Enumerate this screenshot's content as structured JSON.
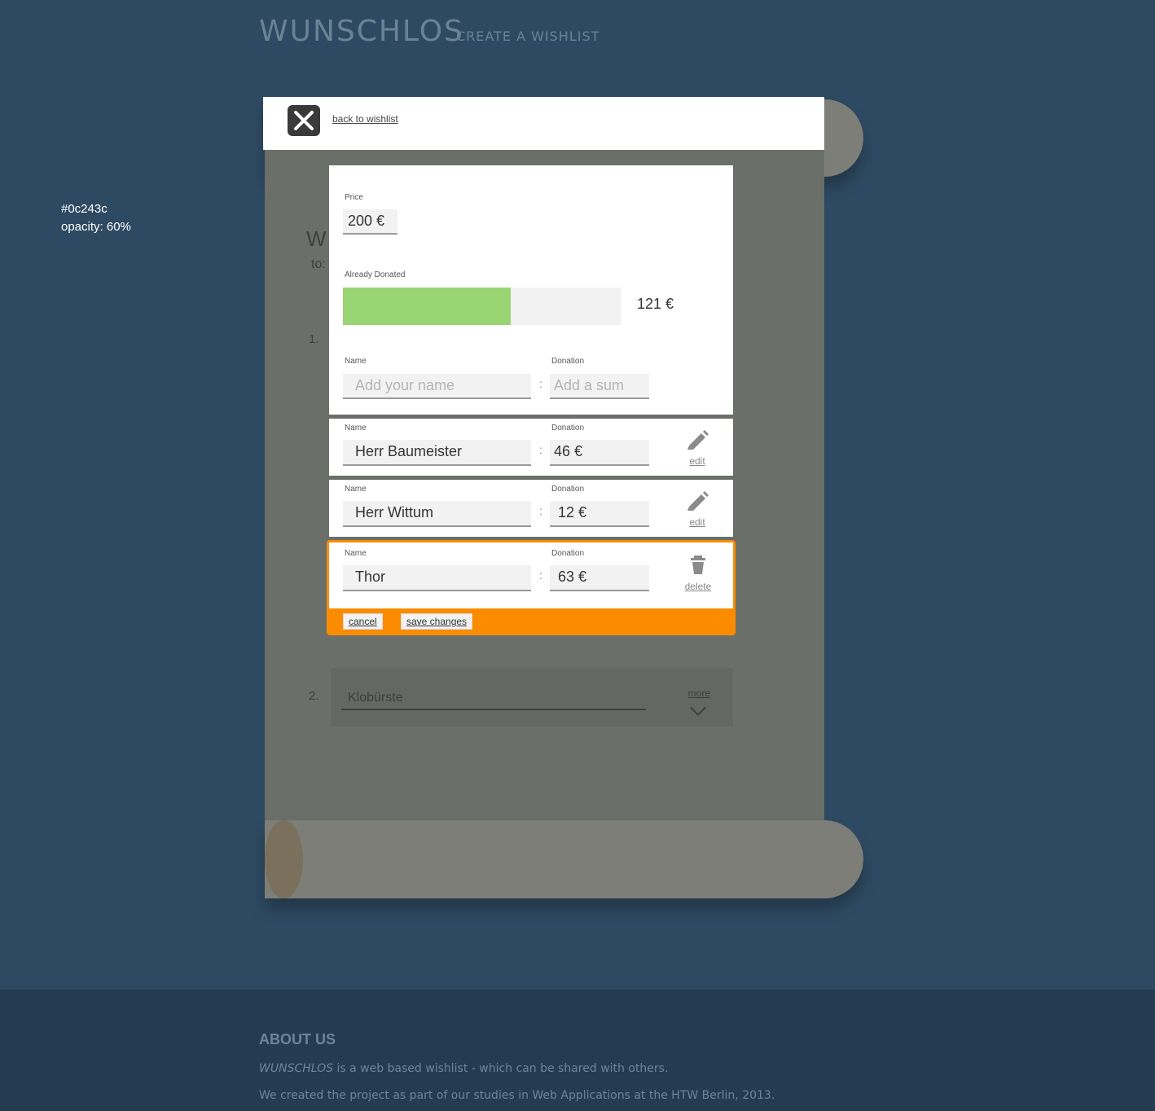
{
  "header": {
    "logo": "WUNSCHLOS",
    "tagline": "CREATE A WISHLIST"
  },
  "annotation": {
    "color_line": "#0c243c",
    "opacity_line": "opacity: 60%"
  },
  "background_list": {
    "title_fragment": "W",
    "to_fragment": "to:",
    "item1_number": "1.",
    "item2_number": "2.",
    "item2_value": "Klobürste",
    "item2_more": "more"
  },
  "modal": {
    "back_link": "back to wishlist",
    "price_label": "Price",
    "price_value": "200 €",
    "donated_label": "Already Donated",
    "donated_amount": "121 €",
    "donated_fraction": 0.605,
    "new_entry": {
      "name_label": "Name",
      "donation_label": "Donation",
      "name_placeholder": "Add your name",
      "sum_placeholder": "Add a sum",
      "separator": ":"
    },
    "donors": [
      {
        "name_label": "Name",
        "donation_label": "Donation",
        "name": "Herr Baumeister",
        "sum": "46 €",
        "action": "edit",
        "separator": ":"
      },
      {
        "name_label": "Name",
        "donation_label": "Donation",
        "name": "Herr Wittum",
        "sum": "12 €",
        "action": "edit",
        "separator": ":"
      },
      {
        "name_label": "Name",
        "donation_label": "Donation",
        "name": "Thor",
        "sum": "63 €",
        "action": "delete",
        "separator": ":"
      }
    ],
    "cancel_label": "cancel",
    "save_label": "save changes"
  },
  "footer": {
    "heading": "ABOUT US",
    "line1_brand": "WUNSCHLOS",
    "line1_rest": " is a web based wishlist - which can be shared with others.",
    "line2": "We created the project as part of our studies in Web Applications at the HTW Berlin, 2013."
  },
  "colors": {
    "accent": "#fb8c00",
    "progress": "#99d472",
    "overlay": "#0c243c"
  }
}
